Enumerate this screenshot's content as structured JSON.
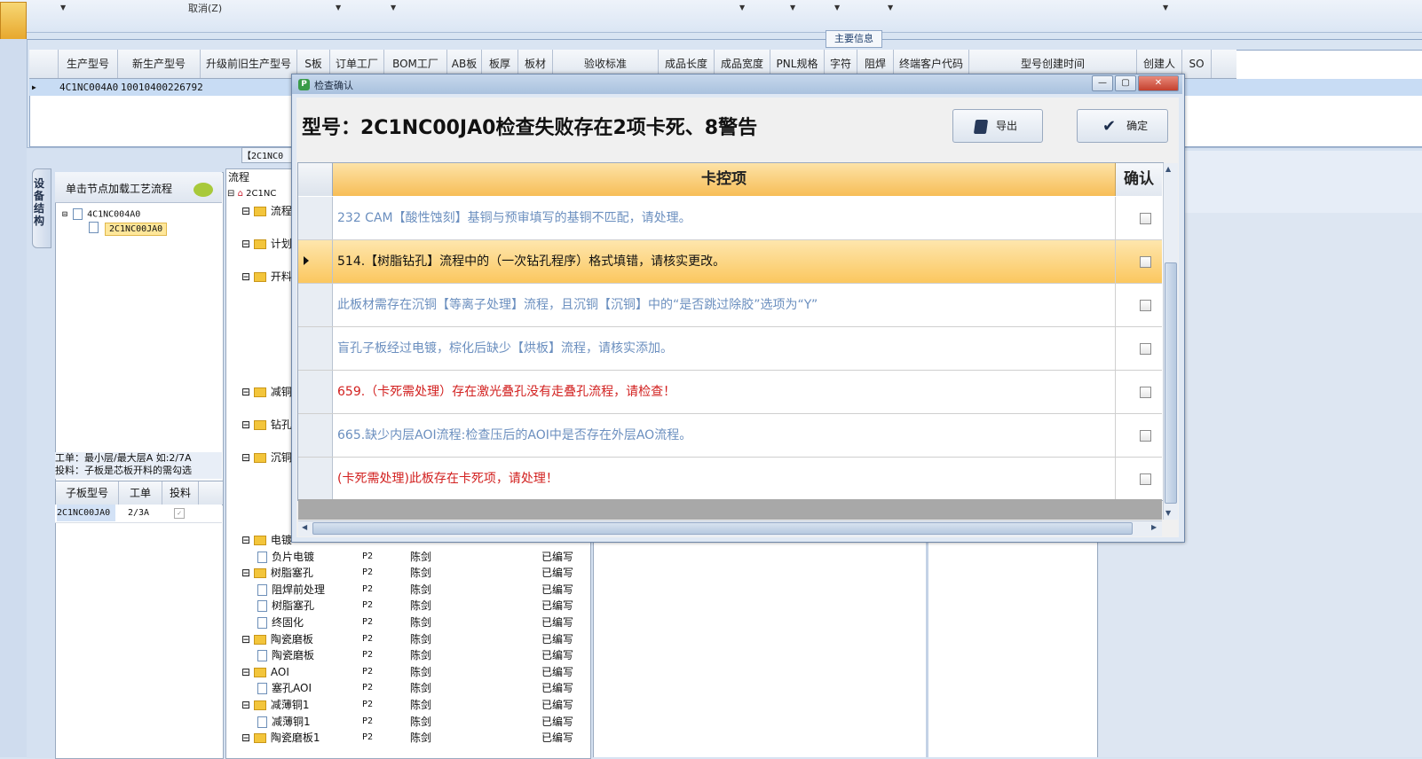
{
  "toolbar": {
    "cancel_label": "取消(Z)"
  },
  "main_info": {
    "label": "主要信息"
  },
  "grid_top": {
    "columns": [
      "生产型号",
      "新生产型号",
      "升级前旧生产型号",
      "S板",
      "订单工厂",
      "BOM工厂",
      "AB板",
      "板厚",
      "板材",
      "验收标准",
      "成品长度",
      "成品宽度",
      "PNL规格",
      "字符",
      "阻焊",
      "终端客户代码",
      "型号创建时间",
      "创建人",
      "SO"
    ],
    "row": {
      "col1": "4C1NC004A0",
      "col2": "10010400226792"
    }
  },
  "left_tab": {
    "label": "设备结构"
  },
  "tree": {
    "head": "单击节点加载工艺流程",
    "node1": "4C1NC004A0",
    "node2": "2C1NC00JA0"
  },
  "info_box": {
    "line1": "工单：最小层/最大层A 如:2/7A",
    "line2": "投料：子板是芯板开料的需勾选"
  },
  "sub_grid": {
    "headers": [
      "子板型号",
      "工单",
      "投料"
    ],
    "row": {
      "model": "2C1NC00JA0",
      "order": "2/3A"
    }
  },
  "flow": {
    "title": "流程",
    "root": "2C1NC",
    "mid_tab": "【2C1NC0",
    "stubs": [
      "流程",
      "计划",
      "开料",
      "减铜",
      "钻孔",
      "沉铜"
    ],
    "rows": [
      {
        "name": "电镀",
        "type": "folder",
        "col1": "",
        "col2": "",
        "col3": ""
      },
      {
        "name": "负片电镀",
        "type": "doc",
        "col1": "P2",
        "col2": "陈剑",
        "col3": "已编写"
      },
      {
        "name": "树脂塞孔",
        "type": "folder",
        "col1": "P2",
        "col2": "陈剑",
        "col3": "已编写"
      },
      {
        "name": "阻焊前处理",
        "type": "doc",
        "col1": "P2",
        "col2": "陈剑",
        "col3": "已编写"
      },
      {
        "name": "树脂塞孔",
        "type": "doc",
        "col1": "P2",
        "col2": "陈剑",
        "col3": "已编写"
      },
      {
        "name": "终固化",
        "type": "doc",
        "col1": "P2",
        "col2": "陈剑",
        "col3": "已编写"
      },
      {
        "name": "陶瓷磨板",
        "type": "folder",
        "col1": "P2",
        "col2": "陈剑",
        "col3": "已编写"
      },
      {
        "name": "陶瓷磨板",
        "type": "doc",
        "col1": "P2",
        "col2": "陈剑",
        "col3": "已编写"
      },
      {
        "name": "AOI",
        "type": "folder",
        "col1": "P2",
        "col2": "陈剑",
        "col3": "已编写"
      },
      {
        "name": "塞孔AOI",
        "type": "doc",
        "col1": "P2",
        "col2": "陈剑",
        "col3": "已编写"
      },
      {
        "name": "减薄铜1",
        "type": "folder",
        "col1": "P2",
        "col2": "陈剑",
        "col3": "已编写"
      },
      {
        "name": "减薄铜1",
        "type": "doc",
        "col1": "P2",
        "col2": "陈剑",
        "col3": "已编写"
      },
      {
        "name": "陶瓷磨板1",
        "type": "folder",
        "col1": "P2",
        "col2": "陈剑",
        "col3": "已编写"
      }
    ]
  },
  "modal": {
    "title": "检查确认",
    "heading": "型号：2C1NC00JA0检查失败存在2项卡死、8警告",
    "export_label": "导出",
    "ok_label": "确定",
    "grid_header": "卡控项",
    "confirm_header": "确认",
    "items": [
      {
        "text": "232 CAM【酸性蚀刻】基铜与预审填写的基铜不匹配，请处理。",
        "color": "blue"
      },
      {
        "text": "514.【树脂钻孔】流程中的（一次钻孔程序）格式填错，请核实更改。",
        "color": "black",
        "selected": true
      },
      {
        "text": "此板材需存在沉铜【等离子处理】流程，且沉铜【沉铜】中的“是否跳过除胶”选项为“Y”",
        "color": "blue"
      },
      {
        "text": "盲孔子板经过电镀，棕化后缺少【烘板】流程，请核实添加。",
        "color": "blue"
      },
      {
        "text": "659.（卡死需处理）存在激光叠孔没有走叠孔流程，请检查！",
        "color": "red"
      },
      {
        "text": "665.缺少内层AOI流程:检查压后的AOI中是否存在外层AO流程。",
        "color": "blue"
      },
      {
        "text": "(卡死需处理)此板存在卡死项，请处理！",
        "color": "red"
      }
    ]
  }
}
